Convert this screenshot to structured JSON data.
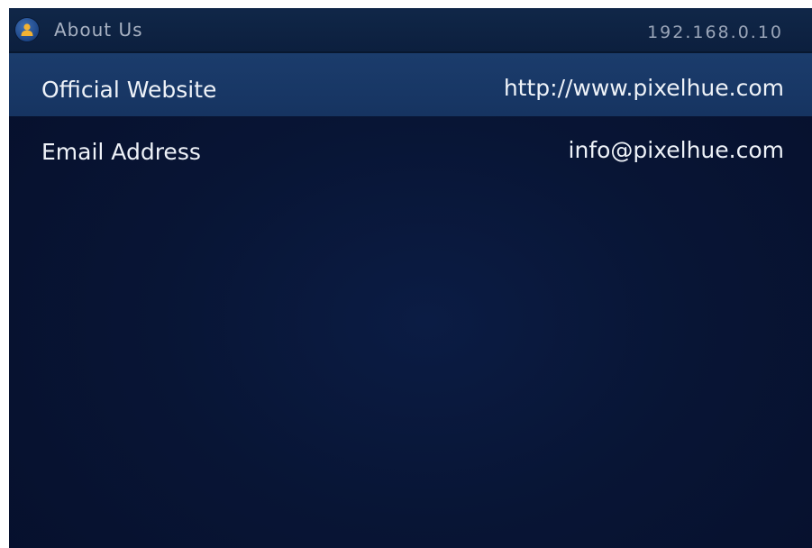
{
  "header": {
    "title": "About Us",
    "ip_address": "192.168.0.10",
    "icon": "user-icon"
  },
  "rows": [
    {
      "label": "Official Website",
      "value": "http://www.pixelhue.com",
      "selected": true
    },
    {
      "label": "Email Address",
      "value": "info@pixelhue.com",
      "selected": false
    }
  ],
  "colors": {
    "background": "#081535",
    "titlebar": "#0c1f3e",
    "selected_row": "#1b3c6c",
    "text": "#eef2f8",
    "icon_accent": "#f2b233"
  }
}
